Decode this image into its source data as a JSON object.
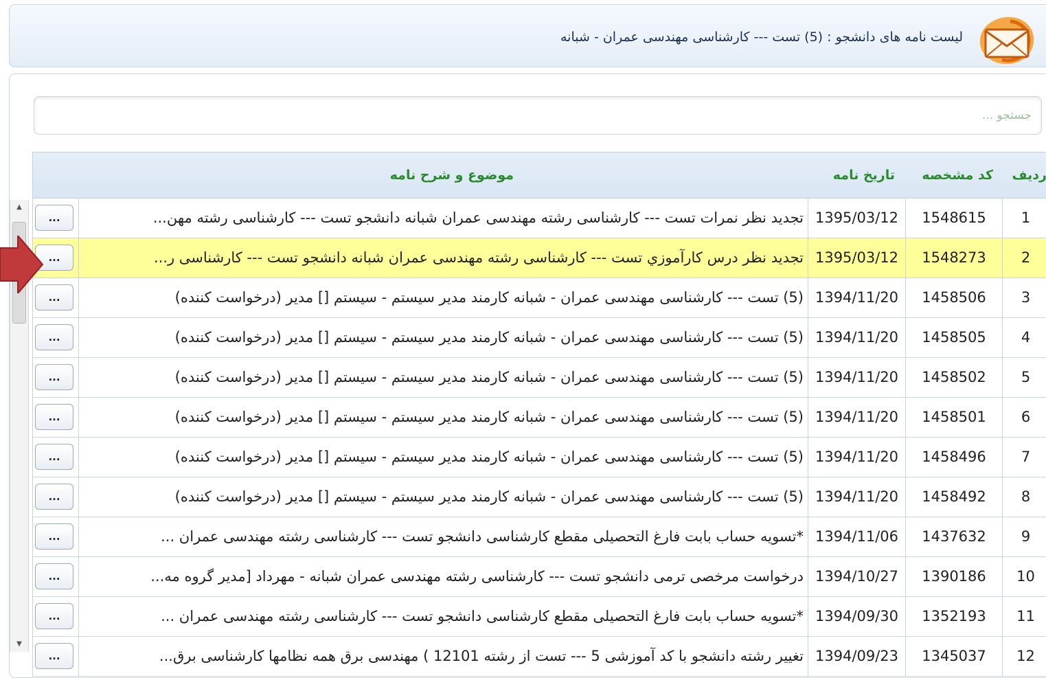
{
  "header": {
    "title": "لیست نامه های دانشجو : (5) تست --- کارشناسی مهندسی عمران - شبانه",
    "icon": "mail-envelope-icon"
  },
  "search": {
    "placeholder": "جستجو ..."
  },
  "columns": {
    "index": "ردیف",
    "code": "کد مشخصه",
    "date": "تاریخ نامه",
    "subject": "موضوع و شرح نامه"
  },
  "action_label": "...",
  "selected_row": 2,
  "colors": {
    "header_text": "#2a8a2e",
    "selected": "#ffff99",
    "arrow": "#c0393b"
  },
  "rows": [
    {
      "index": "1",
      "code": "1548615",
      "date": "1395/03/12",
      "subject": "تجدید نظر نمرات تست --- کارشناسی رشته مهندسی عمران شبانه دانشجو تست --- کارشناسی رشته مهن..."
    },
    {
      "index": "2",
      "code": "1548273",
      "date": "1395/03/12",
      "subject": "تجدید نظر درس کارآموزي تست --- کارشناسی رشته مهندسی عمران شبانه دانشجو تست --- کارشناسی ر..."
    },
    {
      "index": "3",
      "code": "1458506",
      "date": "1394/11/20",
      "subject": "(5) تست --- کارشناسی مهندسی عمران - شبانه کارمند مدیر سیستم - سیستم [] مدیر (درخواست کننده)"
    },
    {
      "index": "4",
      "code": "1458505",
      "date": "1394/11/20",
      "subject": "(5) تست --- کارشناسی مهندسی عمران - شبانه کارمند مدیر سیستم - سیستم [] مدیر (درخواست کننده)"
    },
    {
      "index": "5",
      "code": "1458502",
      "date": "1394/11/20",
      "subject": "(5) تست --- کارشناسی مهندسی عمران - شبانه کارمند مدیر سیستم - سیستم [] مدیر (درخواست کننده)"
    },
    {
      "index": "6",
      "code": "1458501",
      "date": "1394/11/20",
      "subject": "(5) تست --- کارشناسی مهندسی عمران - شبانه کارمند مدیر سیستم - سیستم [] مدیر (درخواست کننده)"
    },
    {
      "index": "7",
      "code": "1458496",
      "date": "1394/11/20",
      "subject": "(5) تست --- کارشناسی مهندسی عمران - شبانه کارمند مدیر سیستم - سیستم [] مدیر (درخواست کننده)"
    },
    {
      "index": "8",
      "code": "1458492",
      "date": "1394/11/20",
      "subject": "(5) تست --- کارشناسی مهندسی عمران - شبانه کارمند مدیر سیستم - سیستم [] مدیر (درخواست کننده)"
    },
    {
      "index": "9",
      "code": "1437632",
      "date": "1394/11/06",
      "subject": "*تسویه حساب بابت فارغ التحصیلی مقطع کارشناسی دانشجو تست --- کارشناسی رشته مهندسی عمران ..."
    },
    {
      "index": "10",
      "code": "1390186",
      "date": "1394/10/27",
      "subject": "درخواست مرخصی ترمی دانشجو تست --- کارشناسی رشته مهندسی عمران شبانه - مهرداد [مدیر گروه مه..."
    },
    {
      "index": "11",
      "code": "1352193",
      "date": "1394/09/30",
      "subject": "*تسویه حساب بابت فارغ التحصیلی مقطع کارشناسی دانشجو تست --- کارشناسی رشته مهندسی عمران ..."
    },
    {
      "index": "12",
      "code": "1345037",
      "date": "1394/09/23",
      "subject": "تغییر رشته دانشجو با کد آموزشی 5 --- تست از رشته 12101 ) مهندسی برق همه نظامها کارشناسی برق..."
    }
  ]
}
